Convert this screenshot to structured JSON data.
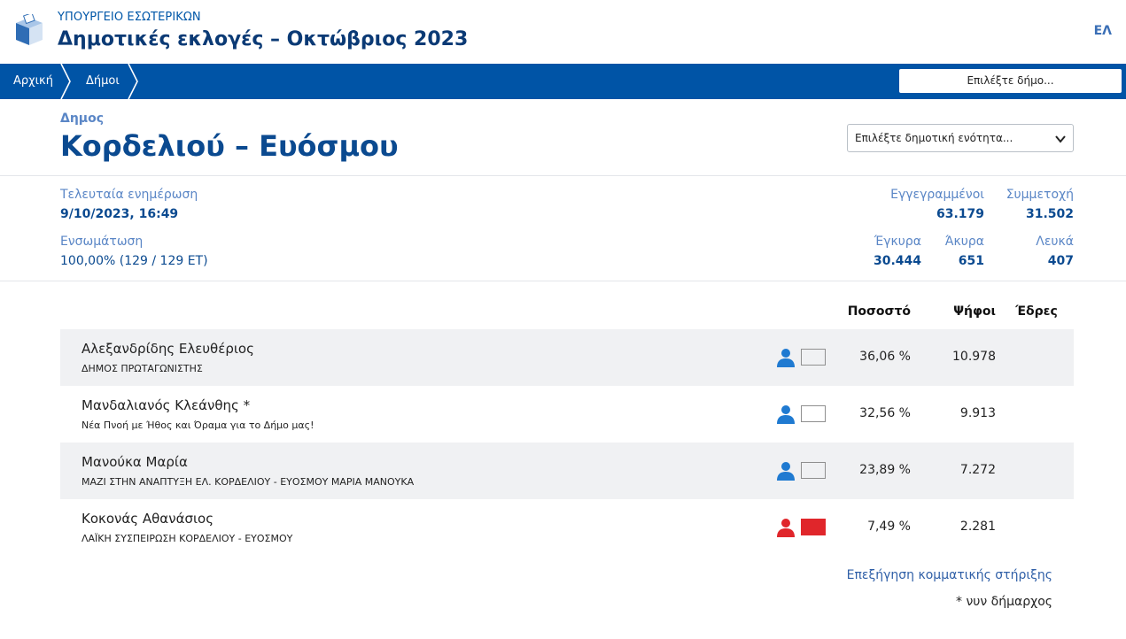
{
  "header": {
    "ministry": "ΥΠΟΥΡΓΕΙΟ ΕΣΩΤΕΡΙΚΩΝ",
    "title": "Δημοτικές εκλογές – Οκτώβριος 2023",
    "language": "ΕΛ"
  },
  "nav": {
    "home": "Αρχική",
    "municipalities": "Δήμοι",
    "select_municipality": "Επιλέξτε δήμο..."
  },
  "municipality": {
    "label": "Δημος",
    "name": "Κορδελιού – Ευόσμου",
    "unit_select": "Επιλέξτε δημοτική ενότητα..."
  },
  "stats": {
    "last_update_label": "Τελευταία ενημέρωση",
    "last_update_value": "9/10/2023, 16:49",
    "integration_label": "Ενσωμάτωση",
    "integration_value": "100,00% (129 / 129 ΕΤ)",
    "registered_label": "Εγγεγραμμένοι",
    "registered_value": "63.179",
    "turnout_label": "Συμμετοχή",
    "turnout_value": "31.502",
    "valid_label": "Έγκυρα",
    "valid_value": "30.444",
    "invalid_label": "Άκυρα",
    "invalid_value": "651",
    "blank_label": "Λευκά",
    "blank_value": "407"
  },
  "table": {
    "headers": {
      "percent": "Ποσοστό",
      "votes": "Ψήφοι",
      "seats": "Έδρες"
    },
    "rows": [
      {
        "candidate": "Αλεξανδρίδης Ελευθέριος",
        "party": "ΔΗΜΟΣ ΠΡΩΤΑΓΩΝΙΣΤΗΣ",
        "percent": "36,06 %",
        "votes": "10.978",
        "seats": "",
        "icon_color": "#1f7ad1",
        "swatch_color": "#f0f1f3"
      },
      {
        "candidate": "Μανδαλιανός Κλεάνθης *",
        "party": "Νέα Πνοή με Ήθος και Όραμα για το Δήμο μας!",
        "percent": "32,56 %",
        "votes": "9.913",
        "seats": "",
        "icon_color": "#1f7ad1",
        "swatch_color": "#ffffff"
      },
      {
        "candidate": "Μανούκα Μαρία",
        "party": "ΜΑΖΙ ΣΤΗΝ ΑΝΑΠΤΥΞΗ ΕΛ. ΚΟΡΔΕΛΙΟΥ - ΕΥΟΣΜΟΥ ΜΑΡΙΑ ΜΑΝΟΥΚΑ",
        "percent": "23,89 %",
        "votes": "7.272",
        "seats": "",
        "icon_color": "#1f7ad1",
        "swatch_color": "#f0f1f3"
      },
      {
        "candidate": "Κοκονάς Αθανάσιος",
        "party": "ΛΑΪΚΗ ΣΥΣΠΕΙΡΩΣΗ ΚΟΡΔΕΛΙΟΥ - ΕΥΟΣΜΟΥ",
        "percent": "7,49 %",
        "votes": "2.281",
        "seats": "",
        "icon_color": "#e0262b",
        "swatch_color": "#e0262b"
      }
    ]
  },
  "footer": {
    "explanation_link": "Επεξήγηση κομματικής στήριξης",
    "note": "* νυν δήμαρχος"
  },
  "colors": {
    "brand_blue": "#0054a6",
    "title_blue": "#0b4a90",
    "label_blue": "#5a86c6"
  }
}
